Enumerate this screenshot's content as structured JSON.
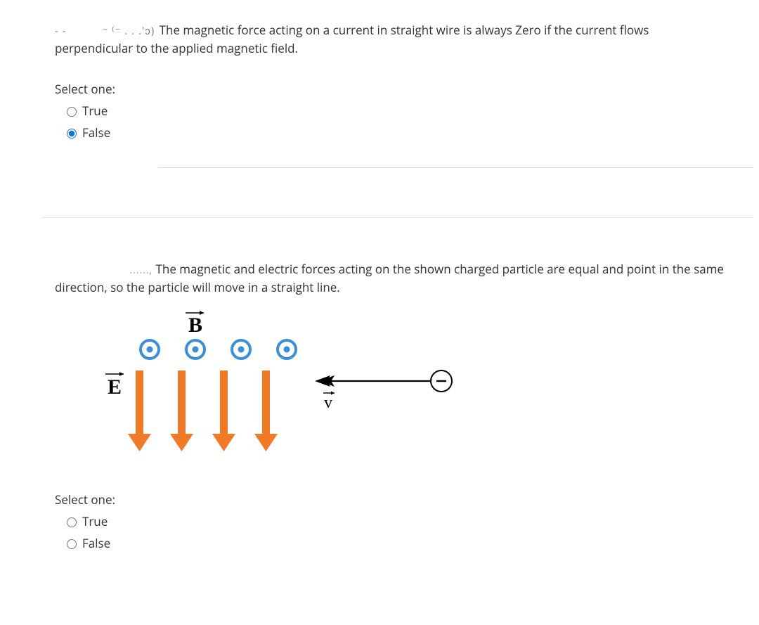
{
  "q1": {
    "prefix_fragment": "- -",
    "mid_fragment": "⁻  ⁽⁻  .   . .'ɔ)",
    "text": "The magnetic force acting on a current in straight wire is always Zero if the current flows perpendicular to the applied magnetic field.",
    "select_label": "Select one:",
    "options": {
      "true": "True",
      "false": "False"
    },
    "selected": "false"
  },
  "q2": {
    "prefix_fragment": "......,",
    "text": "The magnetic and electric forces acting on the shown charged particle are equal and point in the same direction, so the particle will move in a straight line.",
    "select_label": "Select one:",
    "options": {
      "true": "True",
      "false": "False"
    },
    "selected": ""
  },
  "figure": {
    "B_label": "B",
    "E_label": "E",
    "v_label": "v",
    "charge_sign": "−",
    "colors": {
      "orange": "#f07a25",
      "blue": "#3a8fd6",
      "black": "#000000"
    }
  }
}
